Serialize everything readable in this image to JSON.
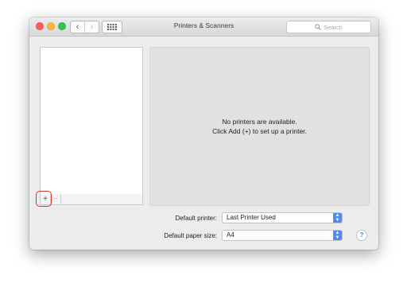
{
  "window": {
    "title": "Printers & Scanners"
  },
  "toolbar": {
    "back_icon": "‹",
    "forward_icon": "›",
    "search_placeholder": "Search"
  },
  "printer_list": {
    "add_label": "+",
    "remove_label": "−"
  },
  "detail": {
    "empty_line1": "No printers are available.",
    "empty_line2": "Click Add (+) to set up a printer."
  },
  "settings": {
    "default_printer_label": "Default printer:",
    "default_printer_value": "Last Printer Used",
    "default_paper_label": "Default paper size:",
    "default_paper_value": "A4"
  },
  "help": {
    "label": "?"
  },
  "colors": {
    "accent": "#4e8cf5",
    "highlight_ring": "#d9342b"
  }
}
